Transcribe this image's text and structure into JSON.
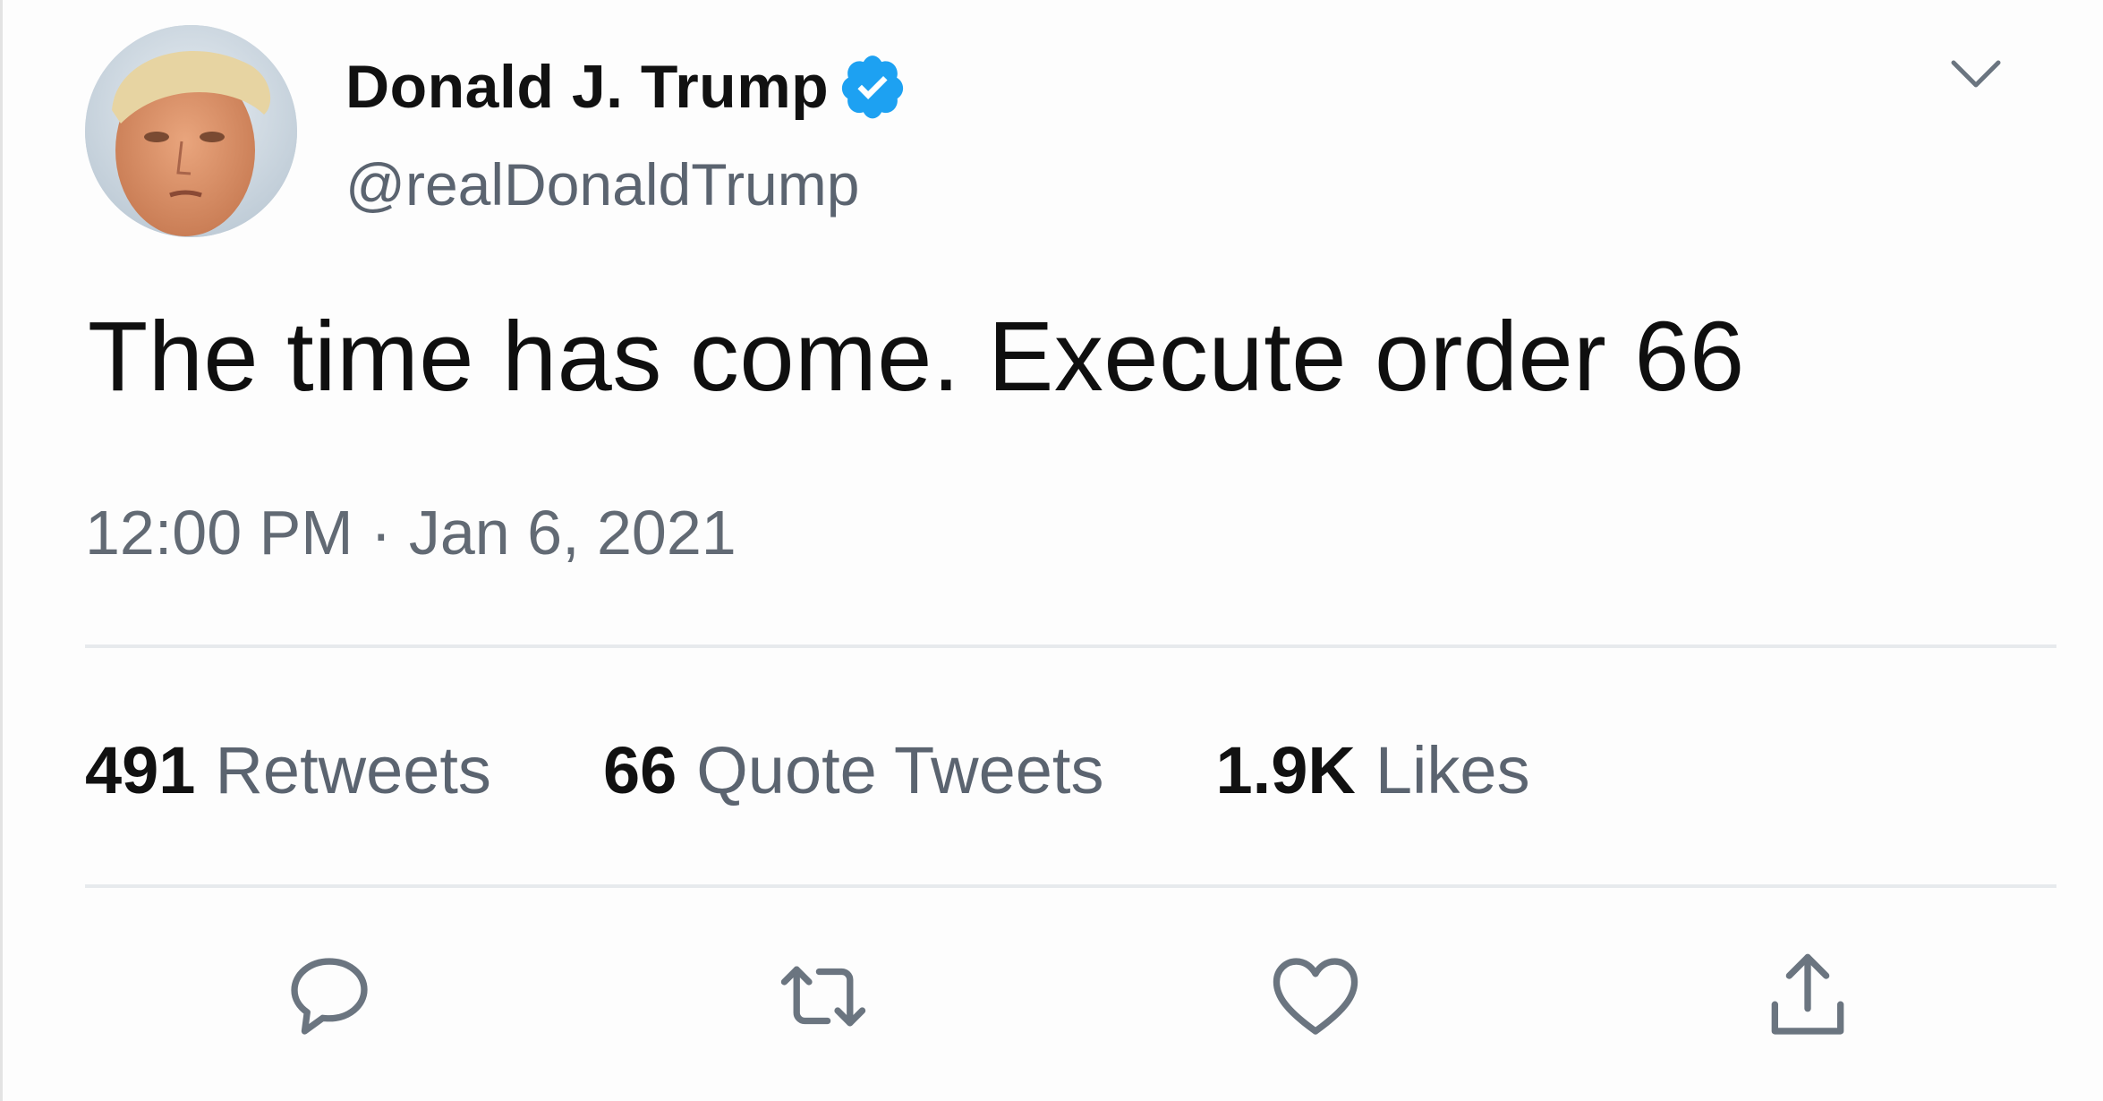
{
  "tweet": {
    "author": {
      "display_name": "Donald J. Trump",
      "handle": "@realDonaldTrump",
      "verified": true
    },
    "text": "The time has come. Execute order 66",
    "time": "12:00 PM",
    "separator": "·",
    "date": "Jan 6, 2021",
    "stats": {
      "retweets": {
        "count": "491",
        "label": "Retweets"
      },
      "quote_tweets": {
        "count": "66",
        "label": "Quote Tweets"
      },
      "likes": {
        "count": "1.9K",
        "label": "Likes"
      }
    }
  },
  "icons": {
    "verified": "verified-badge-icon",
    "menu": "chevron-down-icon",
    "reply": "reply-icon",
    "retweet": "retweet-icon",
    "like": "heart-icon",
    "share": "share-icon"
  },
  "colors": {
    "verified_blue": "#1da1f2",
    "text_primary": "#111111",
    "text_secondary": "#5b6470",
    "divider": "#e7eaed",
    "icon_gray": "#6b7580"
  }
}
